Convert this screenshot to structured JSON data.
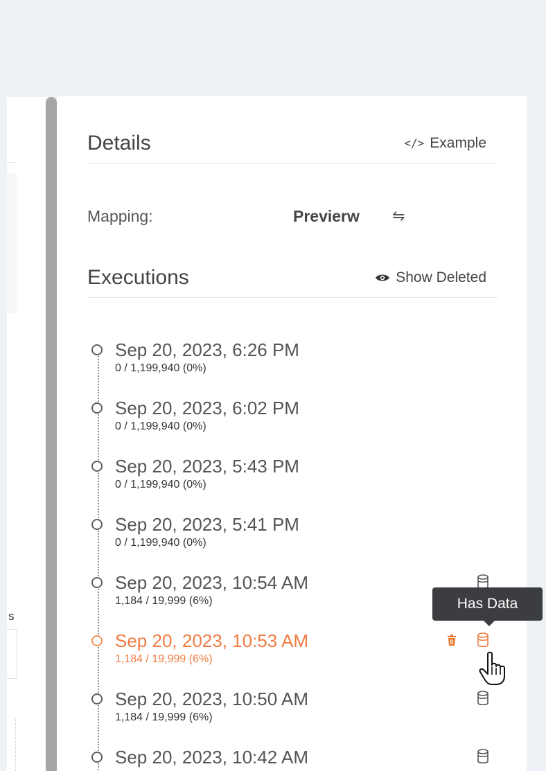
{
  "left_pane": {
    "fragment_text": "s"
  },
  "details": {
    "title": "Details",
    "example_link": {
      "icon": "code-icon",
      "icon_glyph": "</>",
      "label": "Example"
    }
  },
  "mapping": {
    "label": "Mapping:",
    "value": "Previerw",
    "swap_icon": "swap-arrows-icon",
    "swap_glyph": "⇋"
  },
  "executions": {
    "title": "Executions",
    "show_deleted": {
      "icon": "eye-icon",
      "label": "Show Deleted"
    },
    "items": [
      {
        "date": "Sep 20, 2023, 6:26 PM",
        "count": "0 / 1,199,940 (0%)",
        "has_data": false,
        "active": false
      },
      {
        "date": "Sep 20, 2023, 6:02 PM",
        "count": "0 / 1,199,940 (0%)",
        "has_data": false,
        "active": false
      },
      {
        "date": "Sep 20, 2023, 5:43 PM",
        "count": "0 / 1,199,940 (0%)",
        "has_data": false,
        "active": false
      },
      {
        "date": "Sep 20, 2023, 5:41 PM",
        "count": "0 / 1,199,940 (0%)",
        "has_data": false,
        "active": false
      },
      {
        "date": "Sep 20, 2023, 10:54 AM",
        "count": "1,184 / 19,999 (6%)",
        "has_data": true,
        "active": false
      },
      {
        "date": "Sep 20, 2023, 10:53 AM",
        "count": "1,184 / 19,999 (6%)",
        "has_data": true,
        "active": true
      },
      {
        "date": "Sep 20, 2023, 10:50 AM",
        "count": "1,184 / 19,999 (6%)",
        "has_data": true,
        "active": false
      },
      {
        "date": "Sep 20, 2023, 10:42 AM",
        "count": "",
        "has_data": true,
        "active": false
      }
    ]
  },
  "tooltip": {
    "text": "Has Data"
  },
  "colors": {
    "accent": "#f07c43",
    "panel_bg": "#ffffff",
    "page_bg": "#eef1f6",
    "tooltip_bg": "#3b3d40",
    "trash": "#e8742a"
  },
  "icons": {
    "database": "database-icon",
    "trash": "trash-icon",
    "cursor": "hand-pointer-cursor"
  }
}
